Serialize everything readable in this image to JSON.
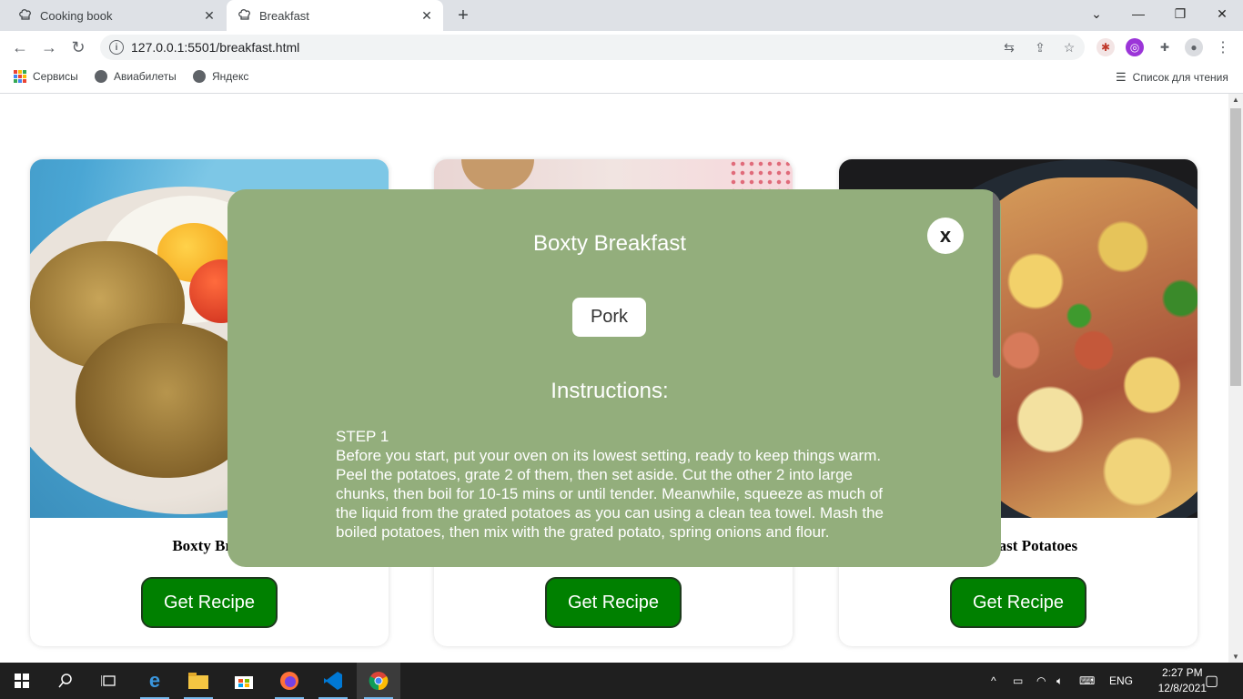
{
  "browser": {
    "tabs": [
      {
        "title": "Cooking book",
        "icon": "chef-hat-icon",
        "active": false
      },
      {
        "title": "Breakfast",
        "icon": "chef-hat-icon",
        "active": true
      }
    ],
    "url": "127.0.0.1:5501/breakfast.html",
    "bookmarks": [
      {
        "label": "Сервисы",
        "icon": "apps-grid-icon"
      },
      {
        "label": "Авиабилеты",
        "icon": "globe-icon"
      },
      {
        "label": "Яндекс",
        "icon": "globe-icon"
      }
    ],
    "reading_list": "Список для чтения"
  },
  "cards": [
    {
      "name": "Boxty Breakfast",
      "button": "Get Recipe"
    },
    {
      "name": "",
      "button": "Get Recipe"
    },
    {
      "name": "Breakfast Potatoes",
      "button": "Get Recipe"
    }
  ],
  "card_visible_text": {
    "left_name_fragment": "Boxty Brea",
    "right_name_fragment": "fast Potatoes"
  },
  "modal": {
    "title": "Boxty Breakfast",
    "close_label": "x",
    "tag": "Pork",
    "instructions_heading": "Instructions:",
    "step_label": "STEP 1",
    "step_text": "Before you start, put your oven on its lowest setting, ready to keep things warm. Peel the potatoes, grate 2 of them, then set aside. Cut the other 2 into large chunks, then boil for 10-15 mins or until tender. Meanwhile, squeeze as much of the liquid from the grated potatoes as you can using a clean tea towel. Mash the boiled potatoes, then mix with the grated potato, spring onions and flour."
  },
  "taskbar": {
    "language": "ENG",
    "time": "2:27 PM",
    "date": "12/8/2021"
  },
  "colors": {
    "modal_bg": "#93ae7c",
    "button_green": "#008000"
  }
}
